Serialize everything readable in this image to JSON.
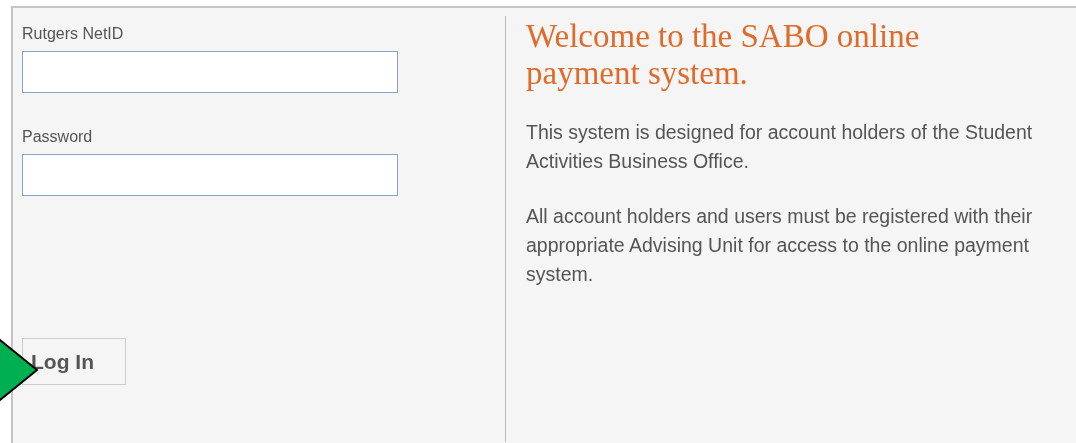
{
  "login_form": {
    "fields": [
      {
        "label": "Rutgers NetID"
      },
      {
        "label": "Password"
      }
    ],
    "submit_button": "Log In"
  },
  "welcome": {
    "heading": "Welcome to the SABO online payment system.",
    "paragraphs": [
      "This system is designed for account holders of the Student Activities Business Office.",
      "All account holders and users must be registered with their appropriate Advising Unit for access to the online payment system."
    ]
  }
}
